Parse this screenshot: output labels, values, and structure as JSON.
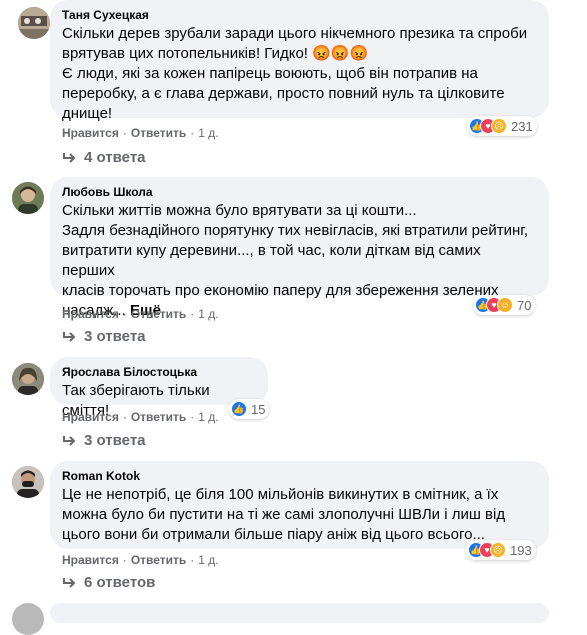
{
  "comments": [
    {
      "author": "Таня Сухецкая",
      "text_lines": [
        "Скільки дерев зрубали заради цього нікчемного презика та спроби",
        "врятував цих потопельників! Гидко! 😡😡😡",
        "Є люди, які за кожен папірець воюють, щоб він потрапив на",
        "переробку, а є глава держави, просто повний нуль та цілковите",
        "днище!"
      ],
      "reaction_count": "231",
      "reaction_icons": [
        "like-icon",
        "love-icon",
        "sad-icon"
      ],
      "like_label": "Нравится",
      "reply_label": "Ответить",
      "time": "1 д.",
      "replies_label": "4 ответа"
    },
    {
      "author": "Любовь Школа",
      "text_lines": [
        "Скільки життів можна було врятувати за ці кошти...",
        "Задля безнадійного порятунку тих невігласів, які втратили рейтинг,",
        "витратити купу деревини..., в той час, коли діткам від самих перших",
        "класів торочать про економію паперу для збереження зелених",
        "насадж..."
      ],
      "more_label": "Ещё",
      "reaction_count": "70",
      "reaction_icons": [
        "like-icon",
        "love-icon",
        "care-icon"
      ],
      "like_label": "Нравится",
      "reply_label": "Ответить",
      "time": "1 д.",
      "replies_label": "3 ответа"
    },
    {
      "author": "Ярослава Білостоцька",
      "text_lines": [
        "Так зберігають тільки сміття!"
      ],
      "reaction_count": "15",
      "reaction_icons": [
        "like-icon"
      ],
      "like_label": "Нравится",
      "reply_label": "Ответить",
      "time": "1 д.",
      "replies_label": "3 ответа"
    },
    {
      "author": "Roman Kotok",
      "text_lines": [
        "Це не непотріб, це біля 100 мільйонів викинутих в смітник, а їх",
        "можна було би пустити на ті же самі злополучні ШВЛи і лиш від",
        "цього вони би отримали більше піару аніж від цього всього..."
      ],
      "reaction_count": "193",
      "reaction_icons": [
        "like-icon",
        "love-icon",
        "sad-icon"
      ],
      "like_label": "Нравится",
      "reply_label": "Ответить",
      "time": "1 д.",
      "replies_label": "6 ответов"
    }
  ]
}
